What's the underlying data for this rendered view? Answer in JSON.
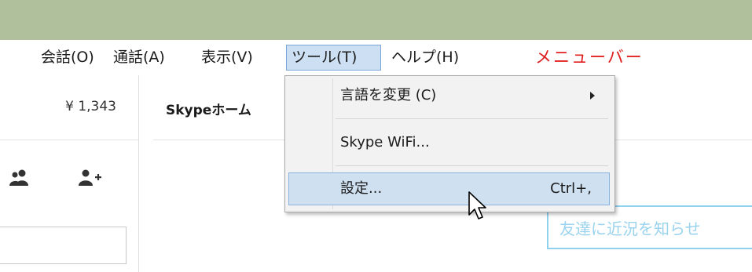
{
  "menubar": {
    "items": [
      {
        "label": "会話(O)"
      },
      {
        "label": "通話(A)"
      },
      {
        "label": "表示(V)"
      },
      {
        "label": "ツール(T)"
      },
      {
        "label": "ヘルプ(H)"
      }
    ],
    "annotation": "メニューバー"
  },
  "left": {
    "credit": "¥ 1,343",
    "icons": [
      "contacts-icon",
      "add-contact-icon"
    ]
  },
  "main": {
    "title": "Skypeホーム",
    "mood_placeholder": "友達に近況を知らせ"
  },
  "tools_menu": {
    "items": [
      {
        "label": "言語を変更 (C)",
        "icon": "submenu-arrow-icon"
      },
      {
        "label": "Skype WiFi..."
      },
      {
        "label": "設定...",
        "shortcut": "Ctrl+,"
      }
    ]
  },
  "colors": {
    "titlebar": "#b0c09c",
    "menu_highlight": "#cde0f3",
    "annotation": "#e02020",
    "mood_border": "#8fd2ee"
  }
}
